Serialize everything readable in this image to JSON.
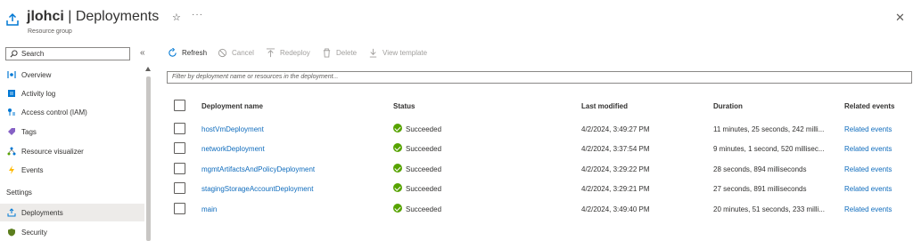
{
  "header": {
    "resource_name": "jlohci",
    "separator": " | ",
    "page_name": "Deployments",
    "subtitle": "Resource group",
    "favorite_glyph": "☆",
    "more_glyph": "···",
    "close_glyph": "✕"
  },
  "sidebar": {
    "search_text": "Search",
    "collapse_glyph": "«",
    "items": [
      {
        "label": "Overview",
        "icon": "overview-icon",
        "color": "#0078d4"
      },
      {
        "label": "Activity log",
        "icon": "activity-log-icon",
        "color": "#0078d4"
      },
      {
        "label": "Access control (IAM)",
        "icon": "access-control-icon",
        "color": "#0078d4"
      },
      {
        "label": "Tags",
        "icon": "tag-icon",
        "color": "#8661c5"
      },
      {
        "label": "Resource visualizer",
        "icon": "resource-visualizer-icon",
        "color": "#0078d4"
      },
      {
        "label": "Events",
        "icon": "events-icon",
        "color": "#ffb900"
      }
    ],
    "settings_label": "Settings",
    "settings_items": [
      {
        "label": "Deployments",
        "icon": "deployments-icon",
        "active": true
      },
      {
        "label": "Security",
        "icon": "security-icon",
        "color": "#5c7e1e"
      }
    ]
  },
  "toolbar": {
    "refresh": "Refresh",
    "cancel": "Cancel",
    "redeploy": "Redeploy",
    "delete": "Delete",
    "view_template": "View template"
  },
  "filter": {
    "placeholder": "Filter by deployment name or resources in the deployment..."
  },
  "table": {
    "columns": [
      "Deployment name",
      "Status",
      "Last modified",
      "Duration",
      "Related events"
    ],
    "rows": [
      {
        "name": "hostVmDeployment",
        "status": "Succeeded",
        "modified": "4/2/2024, 3:49:27 PM",
        "duration": "11 minutes, 25 seconds, 242 milli...",
        "events": "Related events"
      },
      {
        "name": "networkDeployment",
        "status": "Succeeded",
        "modified": "4/2/2024, 3:37:54 PM",
        "duration": "9 minutes, 1 second, 520 millisec...",
        "events": "Related events"
      },
      {
        "name": "mgmtArtifactsAndPolicyDeployment",
        "status": "Succeeded",
        "modified": "4/2/2024, 3:29:22 PM",
        "duration": "28 seconds, 894 milliseconds",
        "events": "Related events"
      },
      {
        "name": "stagingStorageAccountDeployment",
        "status": "Succeeded",
        "modified": "4/2/2024, 3:29:21 PM",
        "duration": "27 seconds, 891 milliseconds",
        "events": "Related events"
      },
      {
        "name": "main",
        "status": "Succeeded",
        "modified": "4/2/2024, 3:49:40 PM",
        "duration": "20 minutes, 51 seconds, 233 milli...",
        "events": "Related events"
      }
    ]
  },
  "colors": {
    "link": "#0f6cbd",
    "success": "#57a300",
    "accent": "#0078d4"
  }
}
